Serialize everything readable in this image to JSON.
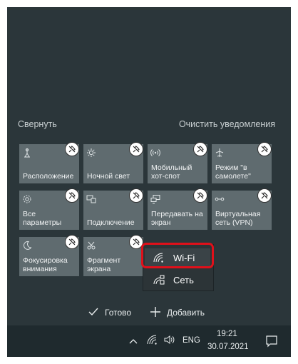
{
  "action_center": {
    "collapse_label": "Свернуть",
    "clear_label": "Очистить уведомления",
    "tiles": [
      {
        "label": "Расположение",
        "icon": "location-icon"
      },
      {
        "label": "Ночной свет",
        "icon": "brightness-icon"
      },
      {
        "label": "Мобильный хот-спот",
        "icon": "hotspot-icon"
      },
      {
        "label": "Режим \"в самолете\"",
        "icon": "airplane-icon"
      },
      {
        "label": "Все параметры",
        "icon": "gear-icon"
      },
      {
        "label": "Подключение",
        "icon": "connect-icon"
      },
      {
        "label": "Передавать на экран",
        "icon": "project-icon"
      },
      {
        "label": "Виртуальная сеть (VPN)",
        "icon": "vpn-icon"
      },
      {
        "label": "Фокусировка внимания",
        "icon": "moon-icon"
      },
      {
        "label": "Фрагмент экрана",
        "icon": "snip-icon"
      }
    ],
    "network_popup": {
      "wifi_label": "Wi-Fi",
      "network_label": "Сеть"
    },
    "done_label": "Готово",
    "add_label": "Добавить"
  },
  "taskbar": {
    "language": "ENG",
    "time": "19:21",
    "date": "30.07.2021"
  },
  "colors": {
    "tile_bg": "#5f6b6f",
    "panel_bg": "#2b363a",
    "taskbar_bg": "#1f2a2e",
    "highlight": "#e0101a"
  }
}
